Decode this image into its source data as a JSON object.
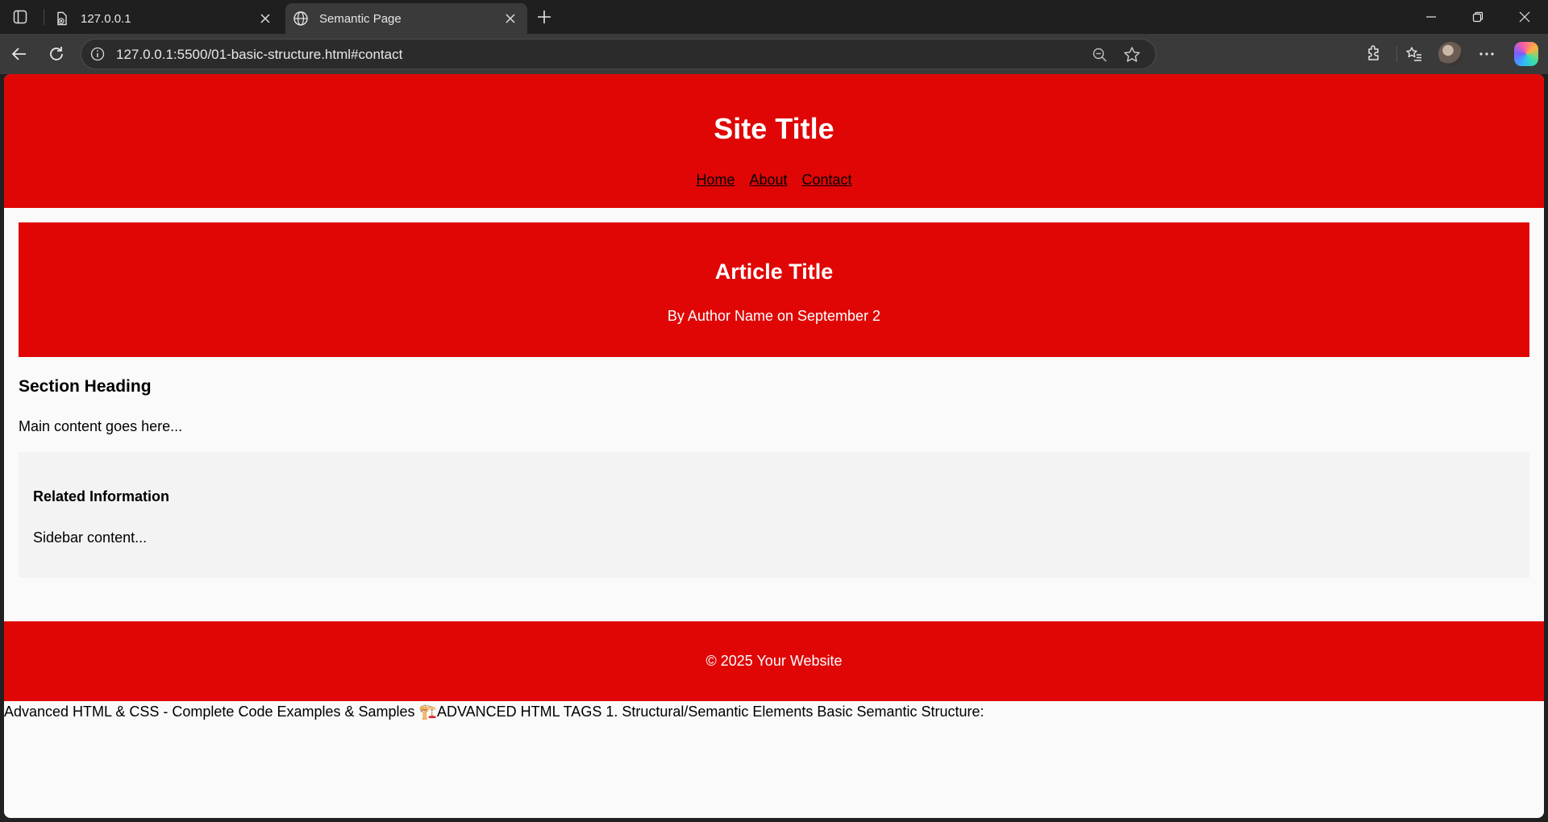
{
  "browser": {
    "tabs": [
      {
        "title": "127.0.0.1",
        "active": false
      },
      {
        "title": "Semantic Page",
        "active": true
      }
    ],
    "url": "127.0.0.1:5500/01-basic-structure.html#contact"
  },
  "page": {
    "header": {
      "title": "Site Title",
      "nav": [
        "Home",
        "About",
        "Contact"
      ]
    },
    "article": {
      "title": "Article Title",
      "meta": "By Author Name on September 2"
    },
    "section": {
      "heading": "Section Heading",
      "content": "Main content goes here..."
    },
    "aside": {
      "heading": "Related Information",
      "content": "Sidebar content..."
    },
    "footer": {
      "text": "© 2025 Your Website"
    },
    "raw_text": "Advanced HTML & CSS - Complete Code Examples & Samples 🏗️ADVANCED HTML TAGS 1. Structural/Semantic Elements Basic Semantic Structure:"
  },
  "colors": {
    "accent_red": "#e00606",
    "page_bg": "#fafafa",
    "aside_bg": "#f3f3f3"
  }
}
